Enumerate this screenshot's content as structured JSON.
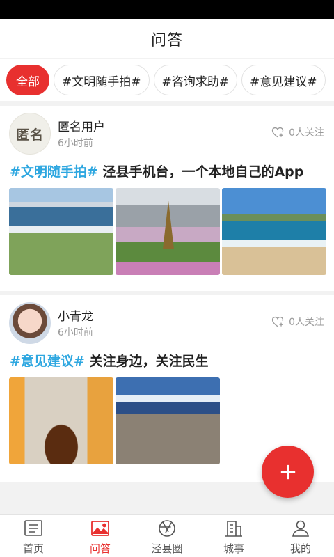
{
  "header": {
    "title": "问答"
  },
  "tags": [
    {
      "label": "全部",
      "active": true
    },
    {
      "label": "#文明随手拍#"
    },
    {
      "label": "#咨询求助#"
    },
    {
      "label": "#意见建议#"
    }
  ],
  "posts": [
    {
      "avatar_text": "匿名",
      "user": "匿名用户",
      "time": "6小时前",
      "followers": "0人关注",
      "hashtag": "#文明随手拍#",
      "text": " 泾县手机台，一个本地自己的App",
      "photos": [
        "coast-photo",
        "paris-photo",
        "beach-photo"
      ]
    },
    {
      "user": "小青龙",
      "time": "6小时前",
      "followers": "0人关注",
      "hashtag": "#意见建议#",
      "text": " 关注身边，关注民生",
      "photos": [
        "coffee-photo",
        "skull-photo"
      ]
    }
  ],
  "tabbar": {
    "items": [
      {
        "label": "首页",
        "icon": "news-icon"
      },
      {
        "label": "问答",
        "icon": "image-icon",
        "active": true
      },
      {
        "label": "泾县圈",
        "icon": "aperture-icon"
      },
      {
        "label": "城事",
        "icon": "building-icon"
      },
      {
        "label": "我的",
        "icon": "person-icon"
      }
    ]
  },
  "colors": {
    "accent": "#e8302f",
    "hashtag": "#2ea7e0",
    "muted": "#999999"
  }
}
